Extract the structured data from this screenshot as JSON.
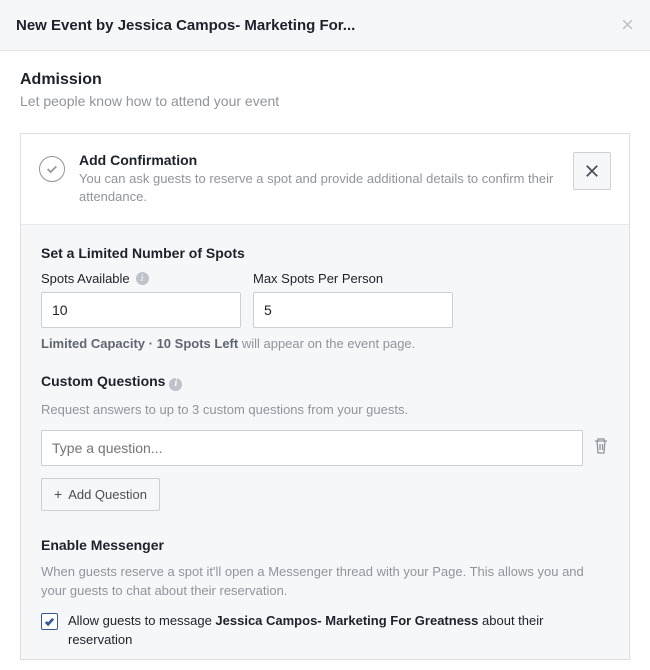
{
  "header": {
    "title": "New Event by Jessica Campos- Marketing For..."
  },
  "admission": {
    "title": "Admission",
    "subtitle": "Let people know how to attend your event"
  },
  "confirmation": {
    "title": "Add Confirmation",
    "desc": "You can ask guests to reserve a spot and provide additional details to confirm their attendance."
  },
  "spots": {
    "heading": "Set a Limited Number of Spots",
    "available_label": "Spots Available",
    "available_value": "10",
    "max_label": "Max Spots Per Person",
    "max_value": "5",
    "caption_strong": "Limited Capacity · 10 Spots Left",
    "caption_rest": " will appear on the event page."
  },
  "questions": {
    "heading": "Custom Questions",
    "desc": "Request answers to up to 3 custom questions from your guests.",
    "placeholder": "Type a question...",
    "add_label": "Add Question"
  },
  "messenger": {
    "heading": "Enable Messenger",
    "desc": "When guests reserve a spot it'll open a Messenger thread with your Page. This allows you and your guests to chat about their reservation.",
    "checkbox_pre": "Allow guests to message ",
    "checkbox_strong": "Jessica Campos- Marketing For Greatness",
    "checkbox_post": " about their reservation",
    "checked": true
  }
}
